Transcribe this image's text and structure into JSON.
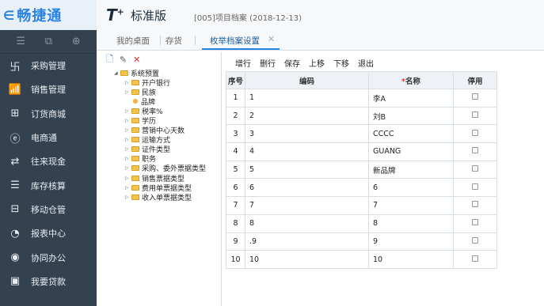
{
  "brand": {
    "arrow": "∈",
    "name": "畅捷通"
  },
  "product": {
    "logo": "T",
    "logo_sup": "+",
    "edition": "标准版",
    "doc_title": "[005]项目档案  (2018-12-13)"
  },
  "leftnav": {
    "tools": [
      "☰",
      "⧉",
      "⊕"
    ],
    "items": [
      {
        "label": "采购管理",
        "icon": "purchase-icon",
        "glyph": "卐"
      },
      {
        "label": "销售管理",
        "icon": "sales-chart-icon",
        "glyph": "📶"
      },
      {
        "label": "订货商城",
        "icon": "mall-icon",
        "glyph": "⊞"
      },
      {
        "label": "电商通",
        "icon": "ecommerce-icon",
        "glyph": "ⓔ"
      },
      {
        "label": "往来现金",
        "icon": "cash-transfer-icon",
        "glyph": "⇄"
      },
      {
        "label": "库存核算",
        "icon": "inventory-icon",
        "glyph": "☰"
      },
      {
        "label": "移动仓管",
        "icon": "mobile-warehouse-icon",
        "glyph": "⊟"
      },
      {
        "label": "报表中心",
        "icon": "report-pie-icon",
        "glyph": "◔"
      },
      {
        "label": "协同办公",
        "icon": "collaboration-icon",
        "glyph": "◉"
      },
      {
        "label": "我要贷款",
        "icon": "loan-icon",
        "glyph": "▣"
      }
    ]
  },
  "tabs": [
    {
      "label": "我的桌面"
    },
    {
      "label": "存货"
    },
    {
      "label": "枚举档案设置"
    }
  ],
  "tree": {
    "toolbar": [
      "🗋",
      "✎",
      "✕"
    ],
    "root": "系统预置",
    "nodes": [
      "开户银行",
      "民族",
      "品牌",
      "税率%",
      "学历",
      "营销中心天数",
      "运输方式",
      "证件类型",
      "职务",
      "采购、委外票据类型",
      "销售票据类型",
      "费用单票据类型",
      "收入单票据类型"
    ]
  },
  "grid": {
    "toolbar": [
      "增行",
      "删行",
      "保存",
      "上移",
      "下移",
      "退出"
    ],
    "headers": {
      "seq": "序号",
      "code": "编码",
      "required_mark": "*",
      "name": "名称",
      "disabled": "停用"
    },
    "rows": [
      {
        "seq": "1",
        "code": "1",
        "name": "李A"
      },
      {
        "seq": "2",
        "code": "2",
        "name": "刘B"
      },
      {
        "seq": "3",
        "code": "3",
        "name": "CCCC"
      },
      {
        "seq": "4",
        "code": "4",
        "name": "GUANG"
      },
      {
        "seq": "5",
        "code": "5",
        "name": "新品牌"
      },
      {
        "seq": "6",
        "code": "6",
        "name": "6"
      },
      {
        "seq": "7",
        "code": "7",
        "name": "7"
      },
      {
        "seq": "8",
        "code": "8",
        "name": "8"
      },
      {
        "seq": "9",
        "code": ".9",
        "name": "9"
      },
      {
        "seq": "10",
        "code": "10",
        "name": "10"
      }
    ]
  }
}
